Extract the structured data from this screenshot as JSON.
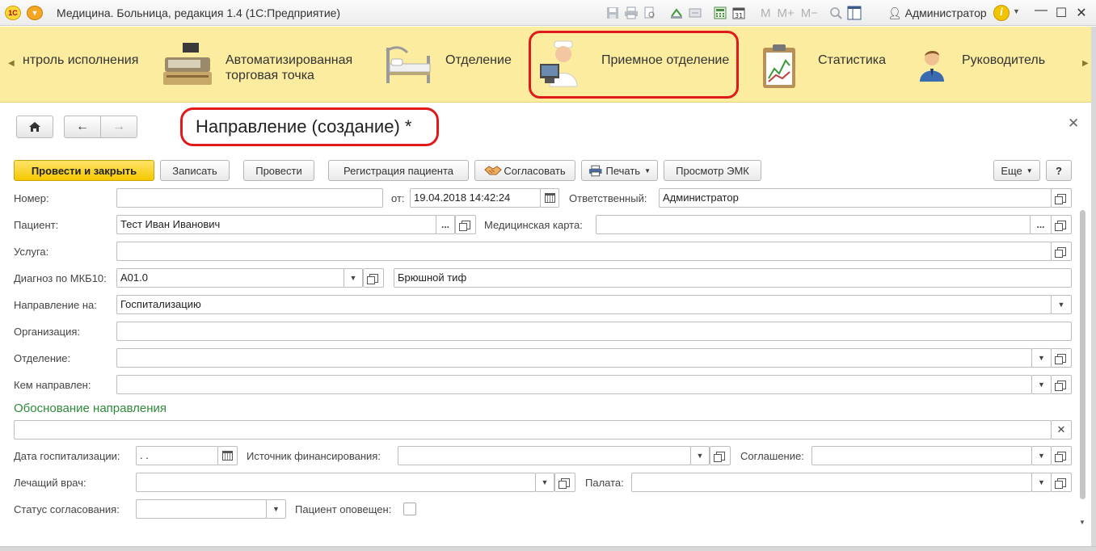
{
  "window": {
    "title": "Медицина. Больница, редакция 1.4 (1С:Предприятие)",
    "logo_text": "1С",
    "user": "Администратор",
    "memory_buttons": [
      "M",
      "M+",
      "M−"
    ],
    "calendar_day": "31"
  },
  "sections": {
    "items": [
      {
        "label": "нтроль исполнения"
      },
      {
        "label": "Автоматизированная торговая точка"
      },
      {
        "label": "Отделение"
      },
      {
        "label": "Приемное отделение"
      },
      {
        "label": "Статистика"
      },
      {
        "label": "Руководитель"
      }
    ],
    "highlight_color": "#e01a1a"
  },
  "form": {
    "title": "Направление (создание) *",
    "toolbar": {
      "post_close": "Провести и закрыть",
      "save": "Записать",
      "post": "Провести",
      "register_patient": "Регистрация пациента",
      "approve": "Согласовать",
      "print": "Печать",
      "view_emk": "Просмотр ЭМК",
      "more": "Еще",
      "help": "?"
    },
    "fields": {
      "number": {
        "label": "Номер:",
        "value": ""
      },
      "date": {
        "label": "от:",
        "value": "19.04.2018 14:42:24"
      },
      "responsible": {
        "label": "Ответственный:",
        "value": "Администратор"
      },
      "patient": {
        "label": "Пациент:",
        "value": "Тест Иван Иванович"
      },
      "medical_card": {
        "label": "Медицинская карта:",
        "value": ""
      },
      "service": {
        "label": "Услуга:",
        "value": ""
      },
      "diagnosis": {
        "label": "Диагноз по МКБ10:",
        "code": "A01.0",
        "name": "Брюшной тиф"
      },
      "direction_to": {
        "label": "Направление на:",
        "value": "Госпитализацию"
      },
      "organization": {
        "label": "Организация:",
        "value": ""
      },
      "department": {
        "label": "Отделение:",
        "value": ""
      },
      "referred_by": {
        "label": "Кем направлен:",
        "value": ""
      },
      "justification": {
        "title": "Обоснование направления",
        "value": ""
      },
      "hosp_date": {
        "label": "Дата госпитализации:",
        "value": " .  ."
      },
      "funding_source": {
        "label": "Источник финансирования:",
        "value": ""
      },
      "agreement": {
        "label": "Соглашение:",
        "value": ""
      },
      "doctor": {
        "label": "Лечащий врач:",
        "value": ""
      },
      "ward": {
        "label": "Палата:",
        "value": ""
      },
      "approval_status": {
        "label": "Статус согласования:",
        "value": ""
      },
      "patient_notified": {
        "label": "Пациент оповещен:",
        "checked": false
      }
    }
  }
}
